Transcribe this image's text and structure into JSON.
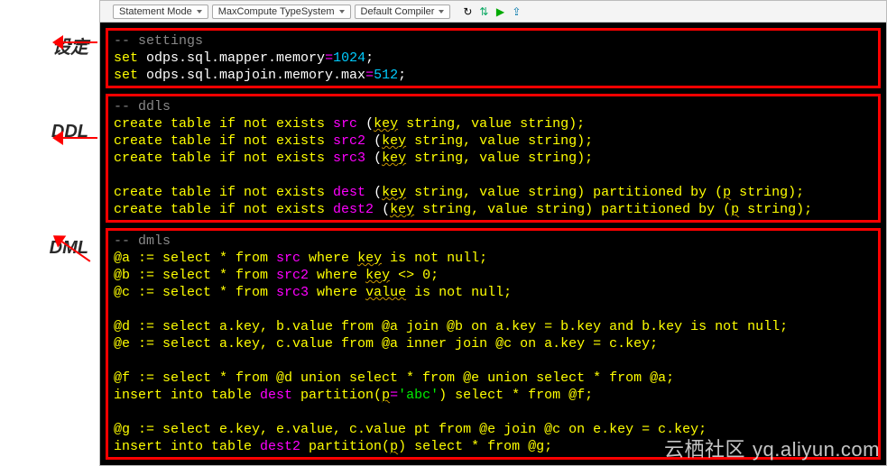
{
  "toolbar": {
    "modes": [
      "Statement Mode",
      "MaxCompute TypeSystem",
      "Default Compiler"
    ],
    "icons": [
      "refresh",
      "sort",
      "play",
      "upload"
    ]
  },
  "labels": {
    "settings": "设定",
    "ddl": "DDL",
    "dml": "DML"
  },
  "code": {
    "settings_comment": "-- settings",
    "set1": {
      "prefix": "set ",
      "prop": "odps.sql.mapper.memory",
      "eq": "=",
      "val": "1024",
      "end": ";"
    },
    "set2": {
      "prefix": "set ",
      "prop": "odps.sql.mapjoin.memory.max",
      "eq": "=",
      "val": "512",
      "end": ";"
    },
    "ddls_comment": "-- ddls",
    "ddl1": {
      "pre": "create table if not exists ",
      "tbl": "src",
      "post": " (",
      "k": "key",
      "r": " string, value string);"
    },
    "ddl2": {
      "pre": "create table if not exists ",
      "tbl": "src2",
      "post": " (",
      "k": "key",
      "r": " string, value string);"
    },
    "ddl3": {
      "pre": "create table if not exists ",
      "tbl": "src3",
      "post": " (",
      "k": "key",
      "r": " string, value string);"
    },
    "ddl4": {
      "pre": "create table if not exists ",
      "tbl": "dest",
      "post": " (",
      "k": "key",
      "r": " string, value string) partitioned by (",
      "p": "p",
      "r2": " string);"
    },
    "ddl5": {
      "pre": "create table if not exists ",
      "tbl": "dest2",
      "post": " (",
      "k": "key",
      "r": " string, value string) partitioned by (",
      "p": "p",
      "r2": " string);"
    },
    "dmls_comment": "-- dmls",
    "dml_a": {
      "l": "@a := select * from ",
      "t": "src",
      "m": " where ",
      "k": "key",
      "r": " is not null;"
    },
    "dml_b": {
      "l": "@b := select * from ",
      "t": "src2",
      "m": " where ",
      "k": "key",
      "r": " <> 0;"
    },
    "dml_c": {
      "l": "@c := select * from ",
      "t": "src3",
      "m": " where ",
      "k": "value",
      "r": " is not null;"
    },
    "dml_d": "@d := select a.key, b.value from @a join @b on a.key = b.key and b.key is not null;",
    "dml_e": "@e := select a.key, c.value from @a inner join @c on a.key = c.key;",
    "dml_f": "@f := select * from @d union select * from @e union select * from @a;",
    "dml_ins1": {
      "l": "insert into table ",
      "t": "dest",
      "m": " partition(",
      "k": "p",
      "e": "=",
      "s": "'abc'",
      "r": ") select * from @f;"
    },
    "dml_g": "@g := select e.key, e.value, c.value pt from @e join @c on e.key = c.key;",
    "dml_ins2": {
      "l": "insert into table ",
      "t": "dest2",
      "m": " partition(",
      "k": "p",
      "r": ") select * from @g;"
    }
  },
  "watermark": {
    "cn": "云栖社区",
    "url": "yq.aliyun.com"
  }
}
